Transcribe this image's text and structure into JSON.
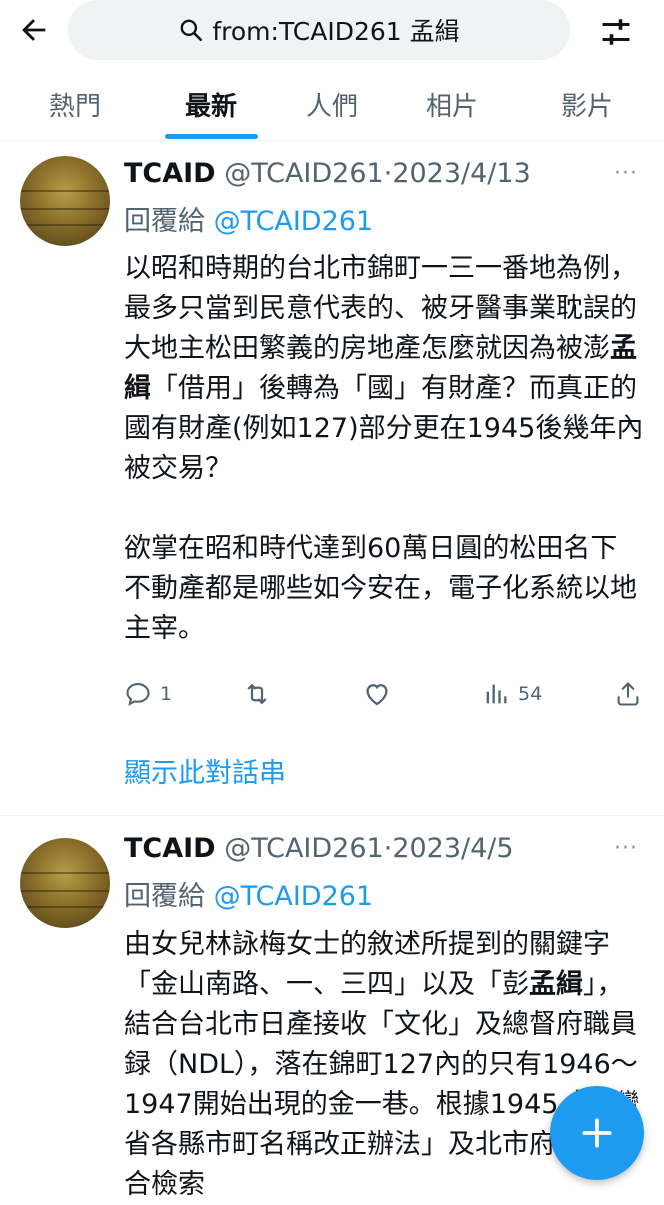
{
  "search": {
    "query": "from:TCAID261 孟緝"
  },
  "tabs": [
    {
      "label": "熱門"
    },
    {
      "label": "最新"
    },
    {
      "label": "人們"
    },
    {
      "label": "相片"
    },
    {
      "label": "影片"
    }
  ],
  "active_tab": "最新",
  "tweets": [
    {
      "name": "TCAID",
      "handle": "@TCAID261",
      "sep": "·",
      "date": "2023/4/13",
      "more": "···",
      "reply_prefix": "回覆給 ",
      "reply_handle": "@TCAID261",
      "p1_a": "以昭和時期的台北市錦町一三一番地為例，最多只當到民意代表的、被牙醫事業耽誤的大地主松田繁義的房地產怎麼就因為被澎",
      "p1_bold": "孟緝",
      "p1_b": "「借用」後轉為「國」有財產？而真正的國有財產(例如127)部分更在1945後幾年內被交易？",
      "p2": "欲掌在昭和時代達到60萬日圓的松田名下不動產都是哪些如今安在，電子化系統以地主宰。",
      "replies": "1",
      "retweets": "",
      "likes": "",
      "views": "54",
      "show_thread": "顯示此對話串"
    },
    {
      "name": "TCAID",
      "handle": "@TCAID261",
      "sep": "·",
      "date": "2023/4/5",
      "more": "···",
      "reply_prefix": "回覆給 ",
      "reply_handle": "@TCAID261",
      "p1_a": "由女兒林詠梅女士的敘述所提到的關鍵字「金山南路、一、三四」以及「彭",
      "p1_bold": "孟緝",
      "p1_b": "」，結合台北市日產接收「文化」及總督府職員録（NDL），落在錦町127內的只有1946～1947開始出現的金一巷。根據1945「臺灣省各縣市町名稱改正辦法」及北市府門牌整合檢索"
    }
  ],
  "icons": {
    "back": "arrow-left-icon",
    "search": "search-icon",
    "filter": "filter-sliders-icon",
    "reply": "reply-icon",
    "retweet": "retweet-icon",
    "like": "heart-icon",
    "views": "views-icon",
    "share": "share-icon",
    "compose": "plus-icon"
  },
  "colors": {
    "accent": "#1d9bf0",
    "text": "#0f1419",
    "muted": "#536471",
    "search_bg": "#eff3f4"
  }
}
